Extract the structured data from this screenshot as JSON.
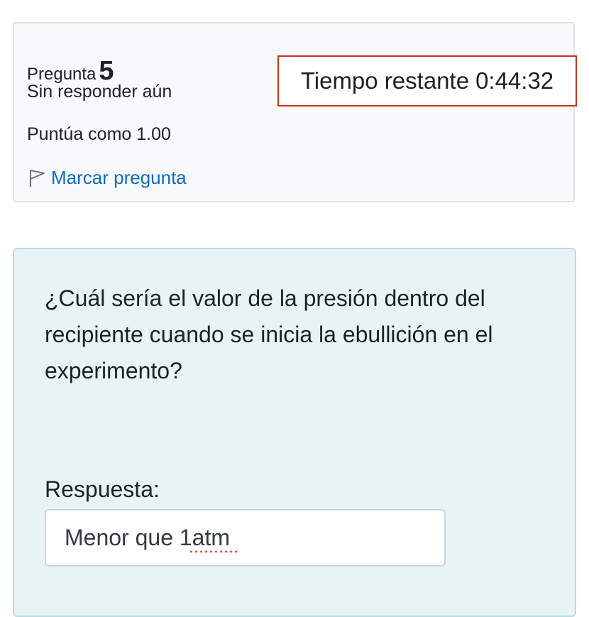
{
  "question_info": {
    "label": "Pregunta",
    "number": "5",
    "state": "Sin responder aún",
    "grade": "Puntúa como 1.00",
    "flag_link": "Marcar pregunta",
    "flag_icon": "flag-outline-icon"
  },
  "timer": {
    "label": "Tiempo restante",
    "value": "0:44:32",
    "border_color": "#ca3120"
  },
  "question": {
    "text": "¿Cuál sería el valor de la presión dentro del recipiente cuando se inicia la ebullición en el experimento?",
    "answer_label": "Respuesta:",
    "answer_value": "Menor que 1atm"
  },
  "colors": {
    "link": "#0f6cbf",
    "content_background": "#e7f3f5",
    "info_background": "#f8f9fa"
  }
}
